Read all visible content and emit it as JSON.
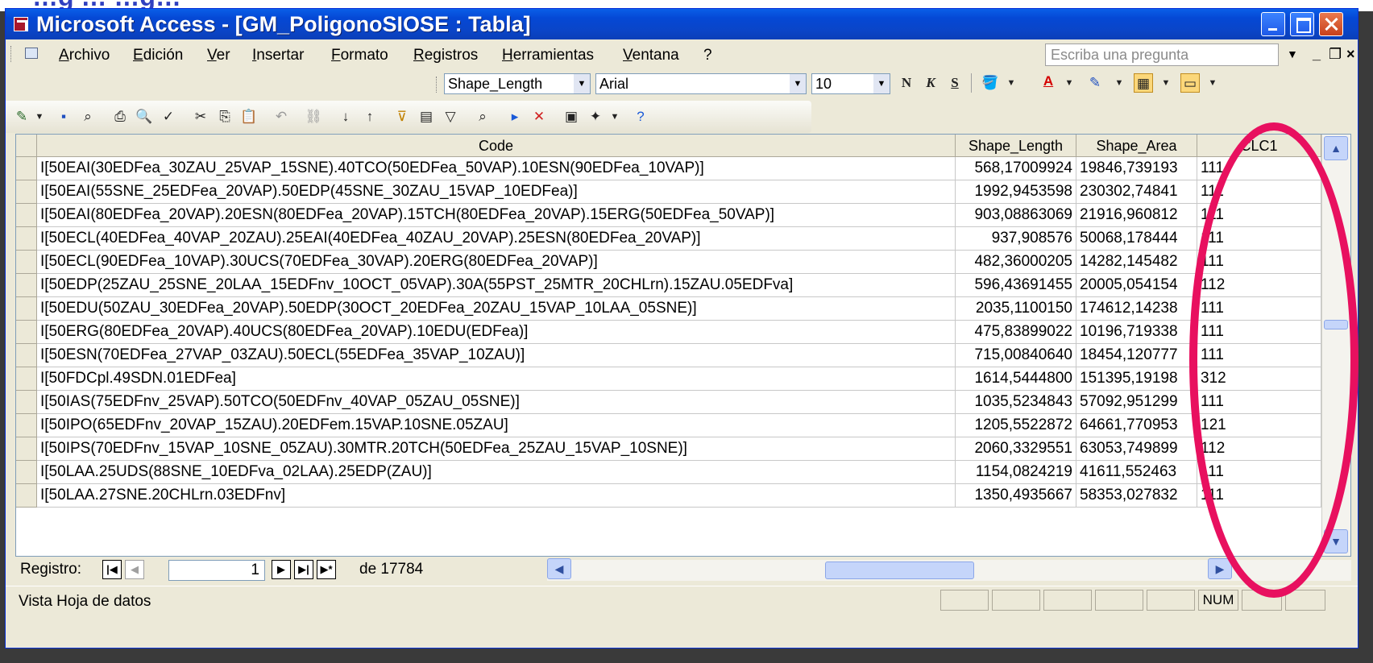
{
  "slide": {
    "top_text": "…g … …g…"
  },
  "window": {
    "title": "Microsoft Access - [GM_PoligonoSIOSE : Tabla]"
  },
  "menu": {
    "items": [
      "Archivo",
      "Edición",
      "Ver",
      "Insertar",
      "Formato",
      "Registros",
      "Herramientas",
      "Ventana",
      "?"
    ],
    "ask_placeholder": "Escriba una pregunta"
  },
  "format_bar": {
    "field": "Shape_Length",
    "font": "Arial",
    "size": "10",
    "bold": "N",
    "italic": "K",
    "underline": "S"
  },
  "table": {
    "columns": [
      "Code",
      "Shape_Length",
      "Shape_Area",
      "CLC1"
    ],
    "rows": [
      [
        "I[50EAI(30EDFea_30ZAU_25VAP_15SNE).40TCO(50EDFea_50VAP).10ESN(90EDFea_10VAP)]",
        "568,17009924",
        "19846,739193",
        "111"
      ],
      [
        "I[50EAI(55SNE_25EDFea_20VAP).50EDP(45SNE_30ZAU_15VAP_10EDFea)]",
        "1992,9453598",
        "230302,74841",
        "111"
      ],
      [
        "I[50EAI(80EDFea_20VAP).20ESN(80EDFea_20VAP).15TCH(80EDFea_20VAP).15ERG(50EDFea_50VAP)]",
        "903,08863069",
        "21916,960812",
        "111"
      ],
      [
        "I[50ECL(40EDFea_40VAP_20ZAU).25EAI(40EDFea_40ZAU_20VAP).25ESN(80EDFea_20VAP)]",
        "937,908576",
        "50068,178444",
        "111"
      ],
      [
        "I[50ECL(90EDFea_10VAP).30UCS(70EDFea_30VAP).20ERG(80EDFea_20VAP)]",
        "482,36000205",
        "14282,145482",
        "111"
      ],
      [
        "I[50EDP(25ZAU_25SNE_20LAA_15EDFnv_10OCT_05VAP).30A(55PST_25MTR_20CHLrn).15ZAU.05EDFva]",
        "596,43691455",
        "20005,054154",
        "112"
      ],
      [
        "I[50EDU(50ZAU_30EDFea_20VAP).50EDP(30OCT_20EDFea_20ZAU_15VAP_10LAA_05SNE)]",
        "2035,1100150",
        "174612,14238",
        "111"
      ],
      [
        "I[50ERG(80EDFea_20VAP).40UCS(80EDFea_20VAP).10EDU(EDFea)]",
        "475,83899022",
        "10196,719338",
        "111"
      ],
      [
        "I[50ESN(70EDFea_27VAP_03ZAU).50ECL(55EDFea_35VAP_10ZAU)]",
        "715,00840640",
        "18454,120777",
        "111"
      ],
      [
        "I[50FDCpl.49SDN.01EDFea]",
        "1614,5444800",
        "151395,19198",
        "312"
      ],
      [
        "I[50IAS(75EDFnv_25VAP).50TCO(50EDFnv_40VAP_05ZAU_05SNE)]",
        "1035,5234843",
        "57092,951299",
        "111"
      ],
      [
        "I[50IPO(65EDFnv_20VAP_15ZAU).20EDFem.15VAP.10SNE.05ZAU]",
        "1205,5522872",
        "64661,770953",
        "121"
      ],
      [
        "I[50IPS(70EDFnv_15VAP_10SNE_05ZAU).30MTR.20TCH(50EDFea_25ZAU_15VAP_10SNE)]",
        "2060,3329551",
        "63053,749899",
        "112"
      ],
      [
        "I[50LAA.25UDS(88SNE_10EDFva_02LAA).25EDP(ZAU)]",
        "1154,0824219",
        "41611,552463",
        "111"
      ],
      [
        "I[50LAA.27SNE.20CHLrn.03EDFnv]",
        "1350,4935667",
        "58353,027832",
        "111"
      ]
    ]
  },
  "navigation": {
    "label": "Registro:",
    "current": "1",
    "of_text": "de 17784"
  },
  "status": {
    "text": "Vista Hoja de datos",
    "num": "NUM"
  }
}
